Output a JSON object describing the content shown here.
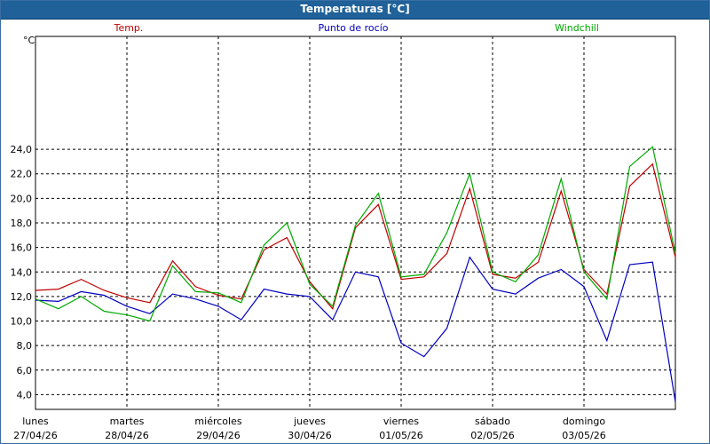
{
  "window": {
    "title": "Temperaturas [°C]"
  },
  "chart_data": {
    "type": "line",
    "title": "Temperaturas [°C]",
    "ylabel": "°C",
    "ylim": [
      2.8,
      33.2
    ],
    "yticks": [
      4,
      6,
      8,
      10,
      12,
      14,
      16,
      18,
      20,
      22,
      24
    ],
    "ytick_labels": [
      "4,0",
      "6,0",
      "8,0",
      "10,0",
      "12,0",
      "14,0",
      "16,0",
      "18,0",
      "20,0",
      "22,0",
      "24,0"
    ],
    "xlim": [
      0,
      7
    ],
    "x_ticks": [
      {
        "day": "lunes",
        "date": "27/04/26"
      },
      {
        "day": "martes",
        "date": "28/04/26"
      },
      {
        "day": "miércoles",
        "date": "29/04/26"
      },
      {
        "day": "jueves",
        "date": "30/04/26"
      },
      {
        "day": "viernes",
        "date": "01/05/26"
      },
      {
        "day": "sábado",
        "date": "02/05/26"
      },
      {
        "day": "domingo",
        "date": "03/05/26"
      }
    ],
    "grid": true,
    "legend": "top",
    "series": [
      {
        "name": "Temp.",
        "color": "#c00000",
        "x": [
          0,
          0.25,
          0.5,
          0.75,
          1,
          1.25,
          1.5,
          1.75,
          2,
          2.25,
          2.5,
          2.75,
          3,
          3.25,
          3.5,
          3.75,
          4,
          4.25,
          4.5,
          4.75,
          5,
          5.25,
          5.5,
          5.75,
          6,
          6.25,
          6.5,
          6.75,
          7
        ],
        "values": [
          12.5,
          12.6,
          13.4,
          12.5,
          11.9,
          11.5,
          14.9,
          12.8,
          12.1,
          11.8,
          15.8,
          16.8,
          13.2,
          11.0,
          17.6,
          19.5,
          13.4,
          13.6,
          15.5,
          20.8,
          13.8,
          13.5,
          14.8,
          20.6,
          14.2,
          12.2,
          21.0,
          22.8,
          15.2
        ]
      },
      {
        "name": "Punto de rocío",
        "color": "#0000c0",
        "x": [
          0,
          0.25,
          0.5,
          0.75,
          1,
          1.25,
          1.5,
          1.75,
          2,
          2.25,
          2.5,
          2.75,
          3,
          3.25,
          3.5,
          3.75,
          4,
          4.25,
          4.5,
          4.75,
          5,
          5.25,
          5.5,
          5.75,
          6,
          6.25,
          6.5,
          6.75,
          7
        ],
        "values": [
          11.7,
          11.6,
          12.4,
          12.1,
          11.2,
          10.6,
          12.2,
          11.8,
          11.2,
          10.1,
          12.6,
          12.2,
          12.0,
          10.1,
          14.0,
          13.6,
          8.2,
          7.1,
          9.4,
          15.2,
          12.6,
          12.2,
          13.5,
          14.2,
          12.8,
          8.4,
          14.6,
          14.8,
          3.4
        ]
      },
      {
        "name": "Windchill",
        "color": "#00aa00",
        "x": [
          0,
          0.25,
          0.5,
          0.75,
          1,
          1.25,
          1.5,
          1.75,
          2,
          2.25,
          2.5,
          2.75,
          3,
          3.25,
          3.5,
          3.75,
          4,
          4.25,
          4.5,
          4.75,
          5,
          5.25,
          5.5,
          5.75,
          6,
          6.25,
          6.5,
          6.75,
          7
        ],
        "values": [
          11.8,
          11.0,
          12.0,
          10.8,
          10.5,
          10.0,
          14.5,
          12.4,
          12.3,
          11.5,
          16.2,
          18.0,
          13.0,
          11.2,
          17.8,
          20.4,
          13.6,
          13.8,
          17.2,
          22.0,
          14.0,
          13.2,
          15.4,
          21.6,
          14.0,
          11.8,
          22.6,
          24.2,
          15.5
        ]
      }
    ]
  }
}
